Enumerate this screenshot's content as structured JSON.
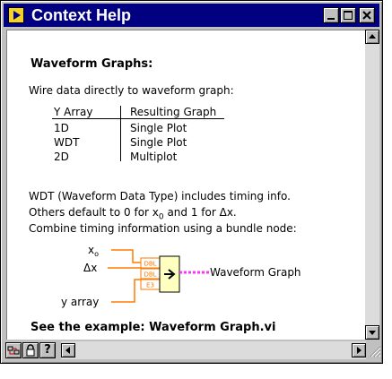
{
  "window": {
    "title": "Context Help"
  },
  "help": {
    "heading": "Waveform Graphs:",
    "intro": "Wire data directly to waveform graph:",
    "table": {
      "headers": [
        "Y Array",
        "Resulting Graph"
      ],
      "rows": [
        [
          "1D",
          "Single Plot"
        ],
        [
          "WDT",
          "Single Plot"
        ],
        [
          "2D",
          "Multiplot"
        ]
      ]
    },
    "wdt_line1": "WDT (Waveform Data Type) includes timing info.",
    "wdt_line2_pre": "Others default to 0 for x",
    "wdt_line2_sub": "0",
    "wdt_line2_post": " and 1 for Δx.",
    "wdt_line3": "Combine timing information using a bundle node:",
    "diagram": {
      "input_x0": "x",
      "input_x0_sub": "o",
      "input_dx": "Δx",
      "input_yarray": "y array",
      "terminal_type": "DBL",
      "terminal_type_array": "E3",
      "output": "Waveform Graph"
    },
    "see_example": "See the example: Waveform Graph.vi"
  },
  "toolbar": {
    "show_detail": "show-block-diagram-icon",
    "lock": "lock-icon",
    "more_help": "?"
  },
  "colors": {
    "title_bar": "#000080",
    "wire_orange": "#ff7a00",
    "wire_pink": "#ff33ff",
    "bundle_fill": "#ffffc0"
  }
}
